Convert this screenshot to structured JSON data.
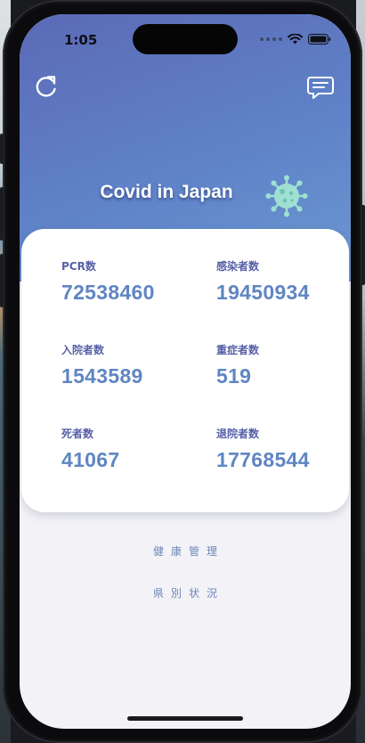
{
  "status_bar": {
    "time": "1:05"
  },
  "header": {
    "refresh_icon": "refresh-icon",
    "chat_icon": "chat-bubble-icon",
    "title": "Covid in Japan",
    "virus_icon": "virus-icon"
  },
  "stats": [
    {
      "label": "PCR数",
      "value": "72538460"
    },
    {
      "label": "感染者数",
      "value": "19450934"
    },
    {
      "label": "入院者数",
      "value": "1543589"
    },
    {
      "label": "重症者数",
      "value": "519"
    },
    {
      "label": "死者数",
      "value": "41067"
    },
    {
      "label": "退院者数",
      "value": "17768544"
    }
  ],
  "menu": {
    "health_management": "健康管理",
    "prefecture_status": "県別状況"
  },
  "colors": {
    "header_gradient_start": "#5c6ab6",
    "header_gradient_end": "#6a98d0",
    "label": "#5760a7",
    "value": "#5f86c2",
    "virus": "#9fe0d2"
  }
}
